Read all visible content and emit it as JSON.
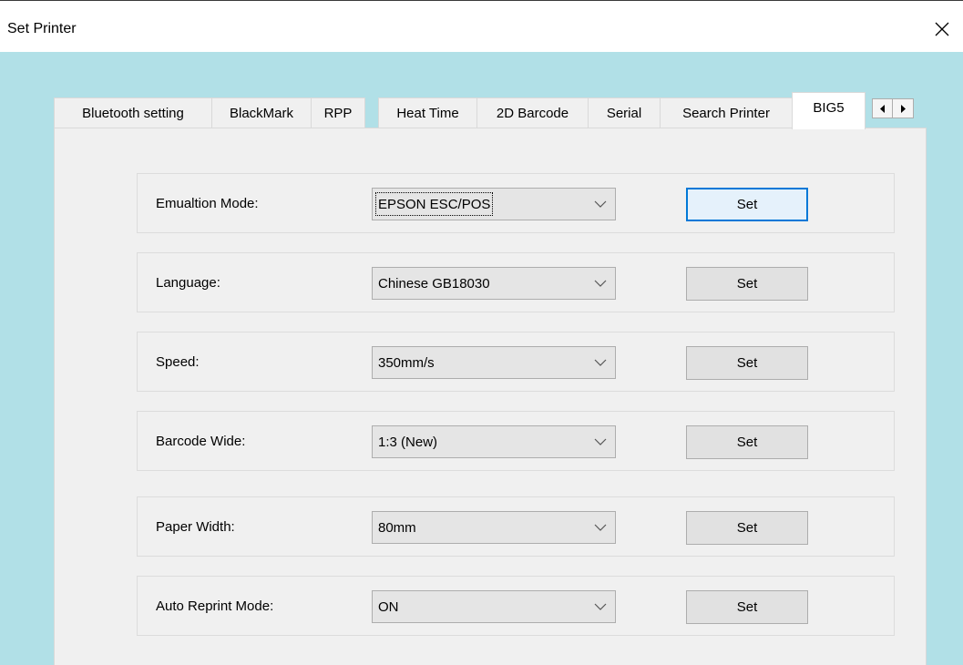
{
  "window": {
    "title": "Set Printer",
    "close_glyph": "×"
  },
  "tabs": [
    {
      "label": "Bluetooth setting",
      "selected": false
    },
    {
      "label": "BlackMark",
      "selected": false
    },
    {
      "label": "RPP",
      "selected": false
    },
    {
      "label": "Heat Time",
      "selected": false
    },
    {
      "label": "2D Barcode",
      "selected": false
    },
    {
      "label": "Serial",
      "selected": false
    },
    {
      "label": "Search Printer",
      "selected": false
    },
    {
      "label": "BIG5",
      "selected": true
    }
  ],
  "tab_scroll": {
    "left_icon": "triangle-left-icon",
    "right_icon": "triangle-right-icon"
  },
  "settings": [
    {
      "label": "Emualtion Mode:",
      "value": "EPSON ESC/POS",
      "button": "Set",
      "focused": true
    },
    {
      "label": "Language:",
      "value": "Chinese GB18030",
      "button": "Set",
      "focused": false
    },
    {
      "label": "Speed:",
      "value": "350mm/s",
      "button": "Set",
      "focused": false
    },
    {
      "label": "Barcode Wide:",
      "value": "1:3 (New)",
      "button": "Set",
      "focused": false
    },
    {
      "label": "Paper Width:",
      "value": "80mm",
      "button": "Set",
      "focused": false
    },
    {
      "label": "Auto Reprint Mode:",
      "value": "ON",
      "button": "Set",
      "focused": false
    }
  ],
  "colors": {
    "frame_background": "#b1e0e7",
    "panel_background": "#f0f0f0",
    "focus_border": "#0078d7"
  }
}
